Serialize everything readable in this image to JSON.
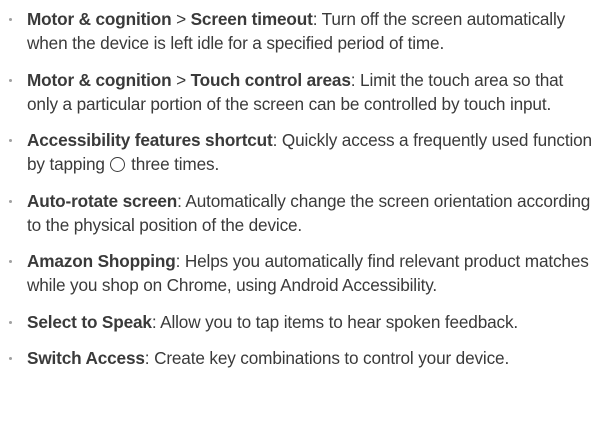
{
  "items": [
    {
      "path_a": "Motor & cognition",
      "sep": " > ",
      "path_b": "Screen timeout",
      "colon": ":",
      "desc": " Turn off the screen automatically when the device is left idle for a specified period of time."
    },
    {
      "path_a": "Motor & cognition",
      "sep": " > ",
      "path_b": "Touch control areas",
      "colon": ":",
      "desc": " Limit the touch area so that only a particular portion of the screen can be controlled by touch input."
    },
    {
      "term": "Accessibility features shortcut",
      "colon": ":",
      "desc_before": " Quickly access a frequently used function by tapping ",
      "icon": "home-circle-icon",
      "desc_after": " three times."
    },
    {
      "term": "Auto-rotate screen",
      "colon": ":",
      "desc": " Automatically change the screen orientation according to the physical position of the device."
    },
    {
      "term": "Amazon Shopping",
      "colon": ":",
      "desc": " Helps you automatically find relevant product matches while you shop on Chrome, using Android Accessibility."
    },
    {
      "term": "Select to Speak",
      "colon": ":",
      "desc": " Allow you to tap items to hear spoken feedback."
    },
    {
      "term": "Switch Access",
      "colon": ":",
      "desc": " Create key combinations to control your device."
    }
  ],
  "colors": {
    "text": "#3a3a3a",
    "bullet": "#a0a0a0"
  }
}
